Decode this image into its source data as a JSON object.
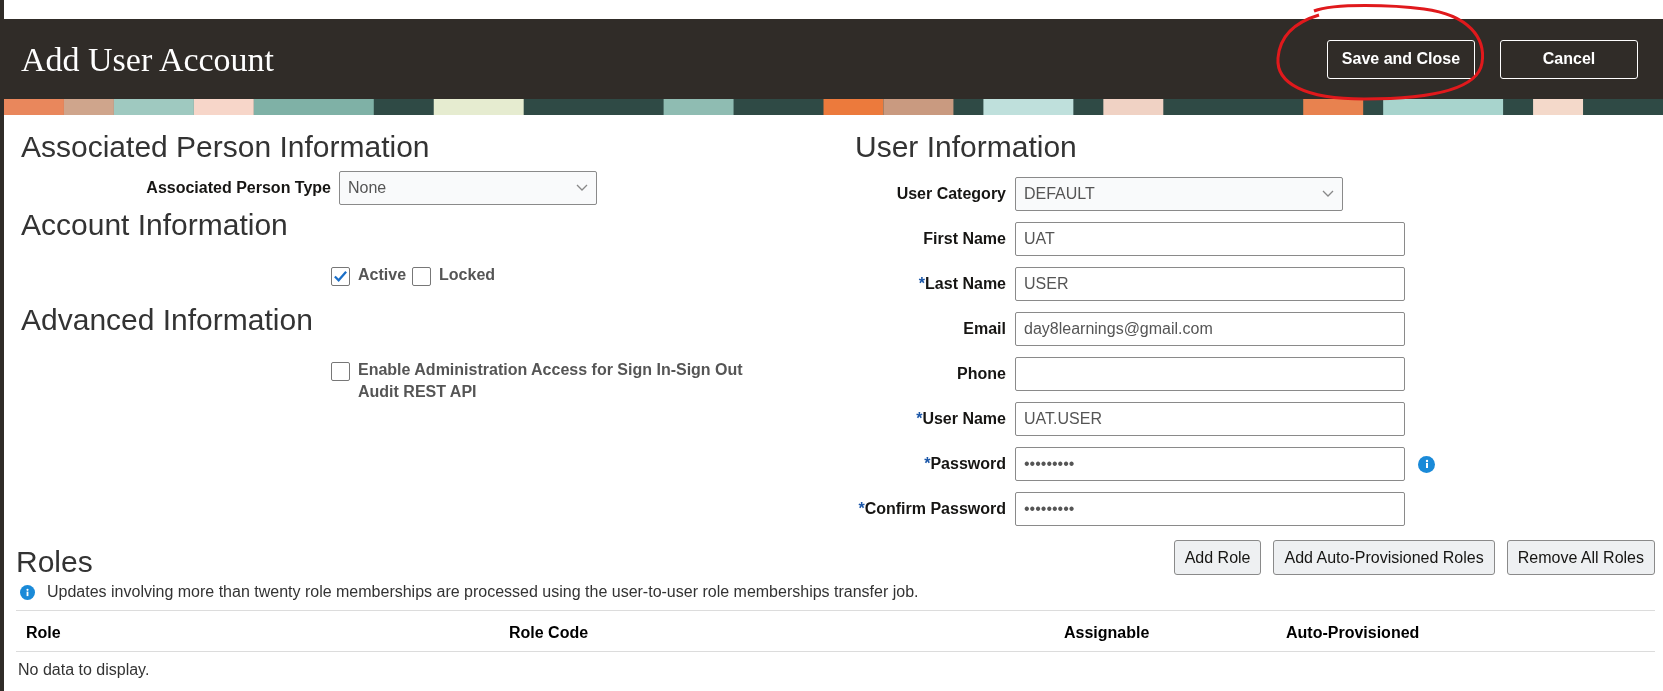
{
  "header": {
    "title": "Add User Account",
    "buttons": [
      {
        "label": "Save and Close",
        "kind": "primary"
      },
      {
        "label": "Cancel",
        "kind": "plain"
      }
    ]
  },
  "left": {
    "sections": [
      {
        "heading": "Associated Person Information",
        "kind": "select",
        "label": "Associated Person Type",
        "value": "None"
      },
      {
        "heading": "Account Information",
        "kind": "checks",
        "checks": [
          {
            "label": "Active",
            "checked": true
          },
          {
            "label": "Locked",
            "checked": false
          }
        ]
      },
      {
        "heading": "Advanced Information",
        "kind": "checks",
        "checks": [
          {
            "label": "Enable Administration Access for Sign In-Sign Out Audit REST API",
            "checked": false
          }
        ]
      }
    ]
  },
  "user_information": {
    "heading": "User Information",
    "fields": [
      {
        "label": "User Category",
        "value": "DEFAULT",
        "kind": "select"
      },
      {
        "label": "First Name",
        "value": "UAT",
        "kind": "text"
      },
      {
        "required_mark": "*",
        "label": "Last Name",
        "value": "USER",
        "kind": "text"
      },
      {
        "label": "Email",
        "value": "day8learnings@gmail.com",
        "kind": "text"
      },
      {
        "label": "Phone",
        "kind": "text"
      },
      {
        "required_mark": "*",
        "label": "User Name",
        "value": "UAT.USER",
        "kind": "text"
      },
      {
        "required_mark": "*",
        "label": "Password",
        "value": "•••••••••",
        "kind": "info"
      },
      {
        "required_mark": "*",
        "label": "Confirm Password",
        "value": "•••••••••",
        "kind": "text"
      }
    ]
  },
  "roles": {
    "heading": "Roles",
    "buttons": [
      "Add Role",
      "Add Auto-Provisioned Roles",
      "Remove All Roles"
    ],
    "note": "Updates involving more than twenty role memberships are processed using the user-to-user role memberships transfer job.",
    "table": {
      "columns": [
        "Role",
        "Role Code",
        "Assignable",
        "Auto-Provisioned"
      ],
      "empty_message": "No data to display."
    }
  }
}
